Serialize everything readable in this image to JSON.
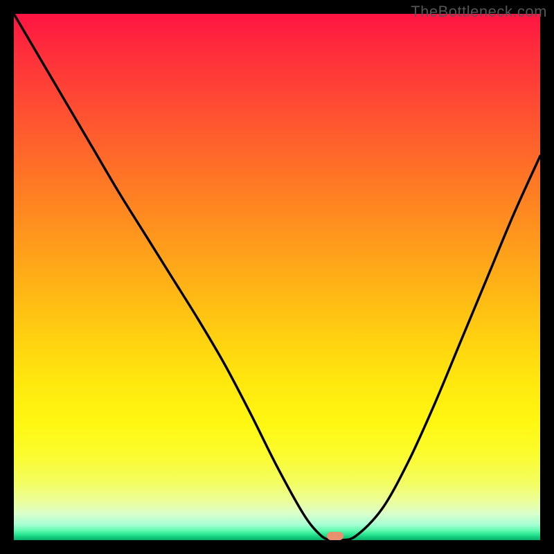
{
  "watermark": "TheBottleneck.com",
  "colors": {
    "frame": "#000000",
    "curve": "#000000",
    "marker": "#e9916f"
  },
  "chart_data": {
    "type": "line",
    "title": "",
    "xlabel": "",
    "ylabel": "",
    "xlim": [
      0,
      100
    ],
    "ylim": [
      0,
      100
    ],
    "grid": false,
    "legend": false,
    "series": [
      {
        "name": "bottleneck-curve",
        "x": [
          0,
          5,
          10,
          15,
          20,
          25,
          30,
          35,
          40,
          45,
          50,
          55,
          58,
          60,
          62,
          65,
          70,
          75,
          80,
          85,
          90,
          95,
          100
        ],
        "y": [
          100,
          91.5,
          83,
          74.5,
          66,
          58,
          50,
          42,
          33.5,
          24,
          14,
          5,
          1.2,
          0,
          0,
          0.8,
          6,
          15,
          26,
          38,
          50,
          62,
          73
        ]
      }
    ],
    "annotations": [
      {
        "name": "optimal-marker",
        "x": 61,
        "y": 0.8
      }
    ],
    "background": {
      "type": "vertical-gradient",
      "stops": [
        {
          "pos": 0,
          "color": "#ff1444"
        },
        {
          "pos": 0.5,
          "color": "#ffba14"
        },
        {
          "pos": 0.85,
          "color": "#fbfc30"
        },
        {
          "pos": 1.0,
          "color": "#0aae6a"
        }
      ]
    }
  }
}
